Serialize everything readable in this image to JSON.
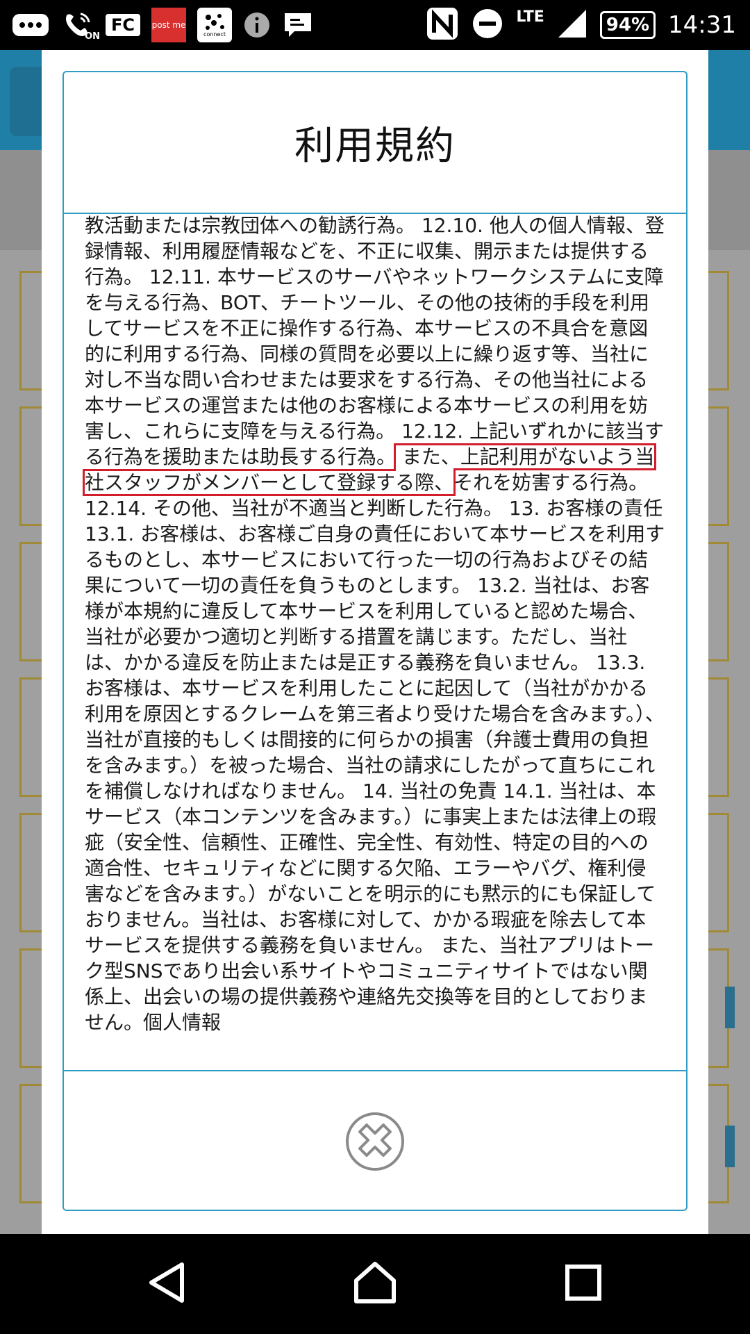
{
  "status_bar": {
    "icons": [
      "chat-bubble-icon",
      "wifi-calling-on-icon",
      "fc-icon",
      "post-me-icon",
      "connect-icon",
      "info-icon",
      "message-icon",
      "nfc-icon",
      "do-not-disturb-icon",
      "signal-icon"
    ],
    "fc_label": "FC",
    "post_me_label": "post me",
    "connect_label": "connect",
    "on_label": "ON",
    "network": "LTE",
    "battery": "94%",
    "time": "14:31"
  },
  "dialog": {
    "title": "利用規約",
    "body_before_highlight": "教活動または宗教団体への勧誘行為。 12.10. 他人の個人情報、登録情報、利用履歴情報などを、不正に収集、開示または提供する行為。 12.11. 本サービスのサーバやネットワークシステムに支障を与える行為、BOT、チートツール、その他の技術的手段を利用してサービスを不正に操作する行為、本サービスの不具合を意図的に利用する行為、同様の質問を必要以上に繰り返す等、当社に対し不当な問い合わせまたは要求をする行為、その他当社による本サービスの運営または他のお客様による本サービスの利用を妨害し、これらに支障を与える行為。 12.12. 上記いずれかに該当する行為を援助または助長する行為。",
    "body_highlight": " また、上記利用がないよう当社スタッフがメンバーとして登録する際、",
    "body_after_highlight": "それを妨害する行為。 12.14. その他、当社が不適当と判断した行為。 13. お客様の責任 13.1. お客様は、お客様ご自身の責任において本サービスを利用するものとし、本サービスにおいて行った一切の行為およびその結果について一切の責任を負うものとします。 13.2. 当社は、お客様が本規約に違反して本サービスを利用していると認めた場合、当社が必要かつ適切と判断する措置を講じます。ただし、当社は、かかる違反を防止または是正する義務を負いません。 13.3. お客様は、本サービスを利用したことに起因して（当社がかかる利用を原因とするクレームを第三者より受けた場合を含みます。）、当社が直接的もしくは間接的に何らかの損害（弁護士費用の負担を含みます。）を被った場合、当社の請求にしたがって直ちにこれを補償しなければなりません。 14. 当社の免責 14.1. 当社は、本サービス（本コンテンツを含みます。）に事実上または法律上の瑕疵（安全性、信頼性、正確性、完全性、有効性、特定の目的への適合性、セキュリティなどに関する欠陥、エラーやバグ、権利侵害などを含みます。）がないことを明示的にも黙示的にも保証しておりません。当社は、お客様に対して、かかる瑕疵を除去して本サービスを提供する義務を負いません。 また、当社アプリはトーク型SNSであり出会い系サイトやコミュニティサイトではない関係上、出会いの場の提供義務や連絡先交換等を目的としておりません。個人情報",
    "close_icon": "close-circle-icon",
    "highlight_color": "#d21d2b",
    "accent_color": "#2f9cc4"
  },
  "nav_bar": {
    "back_icon": "back-triangle-icon",
    "home_icon": "home-icon",
    "recents_icon": "recents-square-icon"
  }
}
